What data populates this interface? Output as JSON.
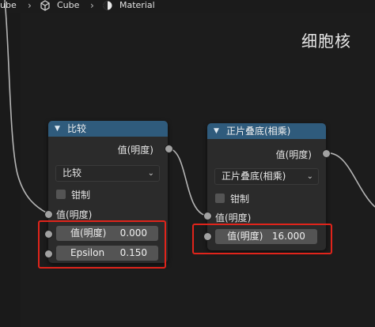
{
  "breadcrumb": {
    "object": "ube",
    "mesh": "Cube",
    "material": "Material"
  },
  "watermark": "细胞核",
  "node_compare": {
    "title": "比较",
    "output": "值(明度)",
    "mode": "比较",
    "clamp_label": "钳制",
    "input_socket": "值(明度)",
    "value_label": "值(明度)",
    "value": "0.000",
    "epsilon_label": "Epsilon",
    "epsilon": "0.150"
  },
  "node_multiply": {
    "title": "正片叠底(相乘)",
    "output": "值(明度)",
    "mode": "正片叠底(相乘)",
    "clamp_label": "钳制",
    "input_socket": "值(明度)",
    "value_label": "值(明度)",
    "value": "16.000"
  },
  "colors": {
    "header": "#2f5b7c",
    "highlight": "#e0241b",
    "socket": "#a1a1a1",
    "field": "#545454"
  }
}
